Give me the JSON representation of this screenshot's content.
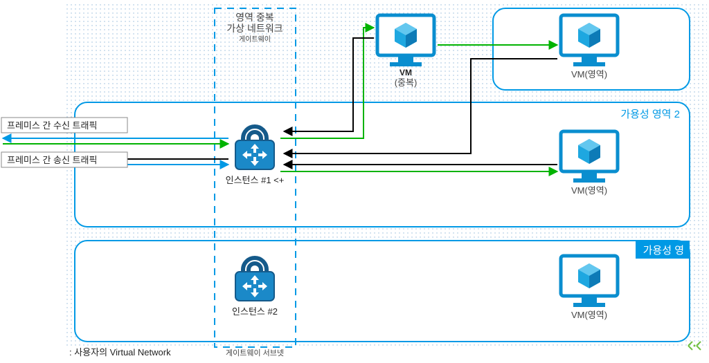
{
  "colors": {
    "blue": "#0099e5",
    "green": "#00b300",
    "black": "#000000",
    "dot": "#1f6fb2",
    "instanceStroke": "#155a8a",
    "instanceFill": "#1b89c8",
    "vmStroke": "#0a8ecf",
    "vmFill": "#1ea7e0"
  },
  "labels": {
    "zoneRedundant1": "영역 중복",
    "zoneRedundant2": "가상 네트워크",
    "gateway": "게이트웨이",
    "vnet": ": 사용자의 Virtual Network",
    "gatewaySubnet": "게이트웨이 서브넷",
    "ingress": "프레미스 간 수신 트래픽",
    "egress": "프레미스 간 송신 트래픽",
    "instance1": "인스턴스 #1 <+",
    "instance2": "인스턴스 #2",
    "vmTop": "VM",
    "vmTopSub": "(중복)",
    "vmZone": "VM(영역)",
    "azone2": "가용성 영역 2",
    "azone3": "가용성 영"
  }
}
